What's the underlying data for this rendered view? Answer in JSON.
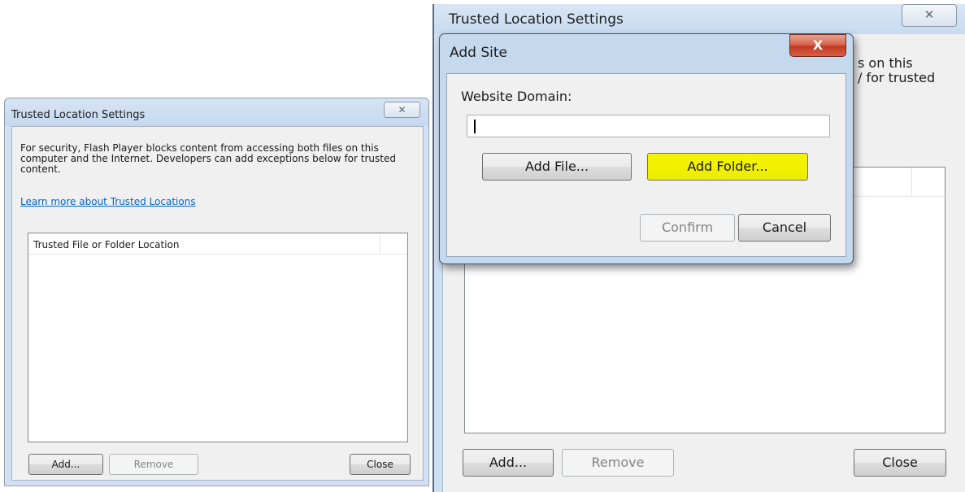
{
  "small_dialog": {
    "title": "Trusted Location Settings",
    "close_glyph": "✕",
    "description": "For security, Flash Player blocks content from accessing both files on this computer and the Internet. Developers can add exceptions below for trusted content.",
    "learn_more_link": "Learn more about Trusted Locations",
    "list_header": "Trusted File or Folder Location",
    "add_button": "Add...",
    "remove_button": "Remove",
    "close_button": "Close"
  },
  "big_dialog": {
    "title": "Trusted Location Settings",
    "close_glyph": "✕",
    "description_tail": "s on this\n/ for trusted",
    "add_button": "Add...",
    "remove_button": "Remove",
    "close_button": "Close"
  },
  "add_site_dialog": {
    "title": "Add Site",
    "close_glyph": "X",
    "website_domain_label": "Website Domain:",
    "website_domain_value": "",
    "add_file_button": "Add File...",
    "add_folder_button": "Add Folder...",
    "confirm_button": "Confirm",
    "cancel_button": "Cancel",
    "colors": {
      "close_button": "#c3391f",
      "add_folder_highlight": "#f0f000"
    }
  }
}
